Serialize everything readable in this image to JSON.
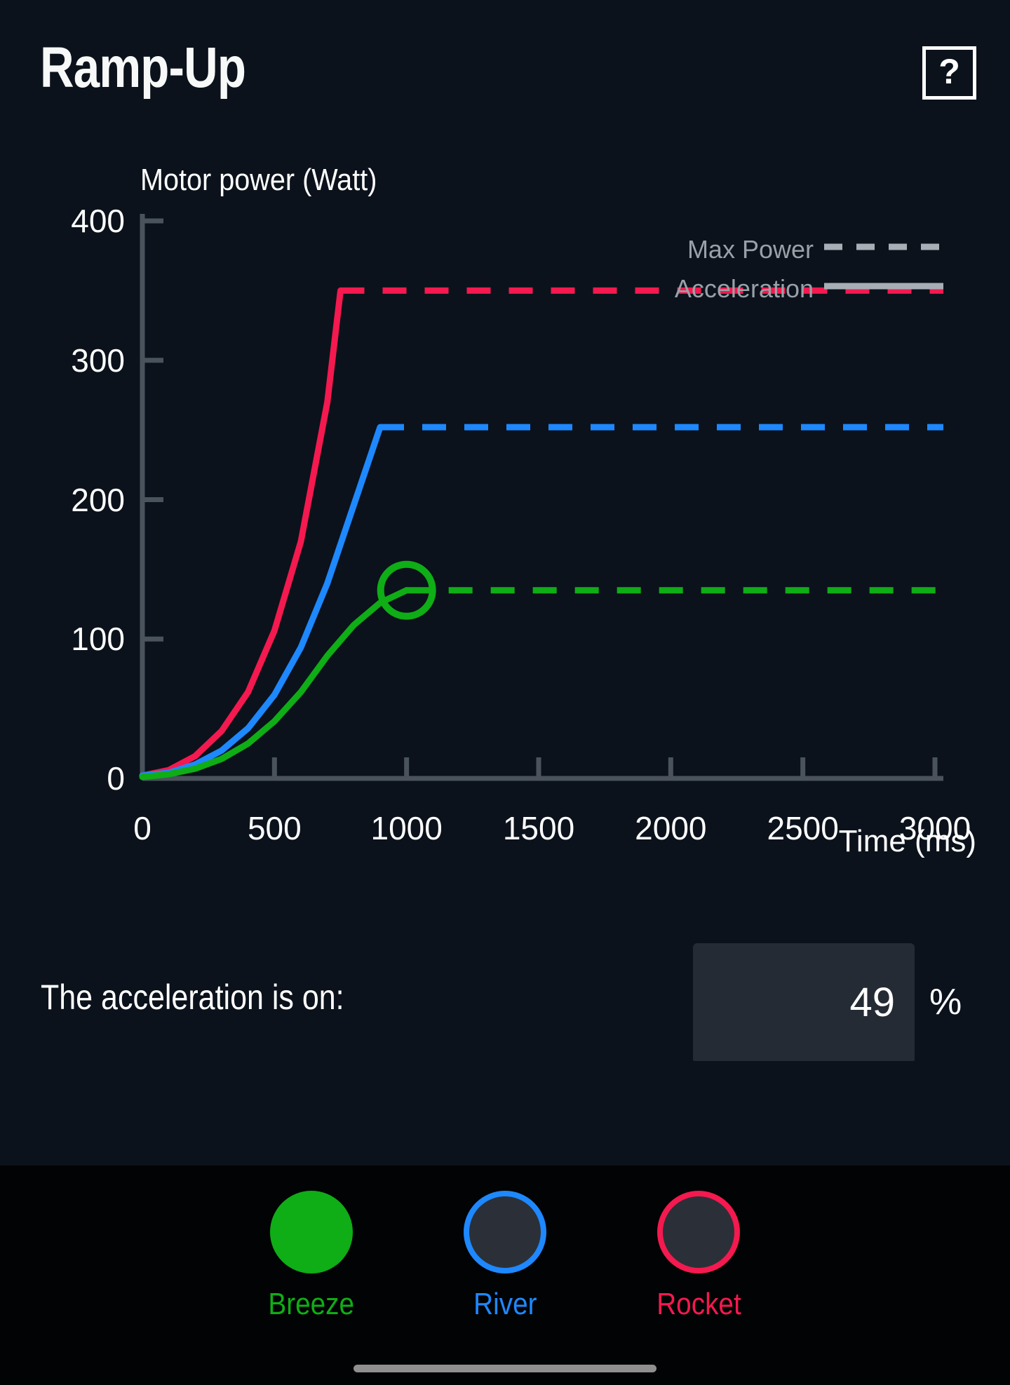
{
  "header": {
    "title": "Ramp-Up",
    "help_label": "?"
  },
  "chart_data": {
    "type": "line",
    "title": "",
    "xlabel": "Time (ms)",
    "ylabel": "Motor power (Watt)",
    "xlim": [
      0,
      3000
    ],
    "ylim": [
      0,
      400
    ],
    "xticks": [
      0,
      500,
      1000,
      1500,
      2000,
      2500,
      3000
    ],
    "yticks": [
      0,
      100,
      200,
      300,
      400
    ],
    "grid": false,
    "legend_position": "top-right",
    "legend": [
      {
        "label": "Max Power",
        "style": "dashed",
        "color": "#a8aeb5"
      },
      {
        "label": "Acceleration",
        "style": "solid",
        "color": "#a8aeb5"
      }
    ],
    "series": [
      {
        "name": "Rocket",
        "color": "#f4194f",
        "max_power": 350,
        "ramp_end_ms": 750,
        "accel_style": "solid",
        "plateau_style": "dashed",
        "x": [
          0,
          100,
          200,
          300,
          400,
          500,
          600,
          700,
          750,
          1000,
          1500,
          2000,
          2500,
          3000
        ],
        "y": [
          2,
          6,
          16,
          34,
          62,
          106,
          170,
          270,
          350,
          350,
          350,
          350,
          350,
          350
        ]
      },
      {
        "name": "River",
        "color": "#1e88ff",
        "max_power": 252,
        "ramp_end_ms": 900,
        "accel_style": "solid",
        "plateau_style": "dashed",
        "x": [
          0,
          100,
          200,
          300,
          400,
          500,
          600,
          700,
          800,
          900,
          1000,
          1500,
          2000,
          2500,
          3000
        ],
        "y": [
          2,
          4,
          10,
          20,
          36,
          60,
          94,
          140,
          196,
          252,
          252,
          252,
          252,
          252,
          252
        ]
      },
      {
        "name": "Breeze",
        "color": "#0fad16",
        "max_power": 135,
        "ramp_end_ms": 1000,
        "accel_style": "solid",
        "plateau_style": "dashed",
        "marker": {
          "x": 1000,
          "y": 135,
          "shape": "circle"
        },
        "x": [
          0,
          100,
          200,
          300,
          400,
          500,
          600,
          700,
          800,
          900,
          1000,
          1500,
          2000,
          2500,
          3000
        ],
        "y": [
          1,
          3,
          7,
          14,
          25,
          41,
          62,
          88,
          110,
          126,
          135,
          135,
          135,
          135,
          135
        ]
      }
    ]
  },
  "acceleration": {
    "label": "The acceleration is on:",
    "value": "49",
    "placeholder": "0",
    "unit": "%"
  },
  "modes": {
    "items": [
      {
        "label": "Breeze",
        "color": "#0fad16",
        "selected": true
      },
      {
        "label": "River",
        "color": "#1e88ff",
        "selected": false
      },
      {
        "label": "Rocket",
        "color": "#f4194f",
        "selected": false
      }
    ]
  }
}
